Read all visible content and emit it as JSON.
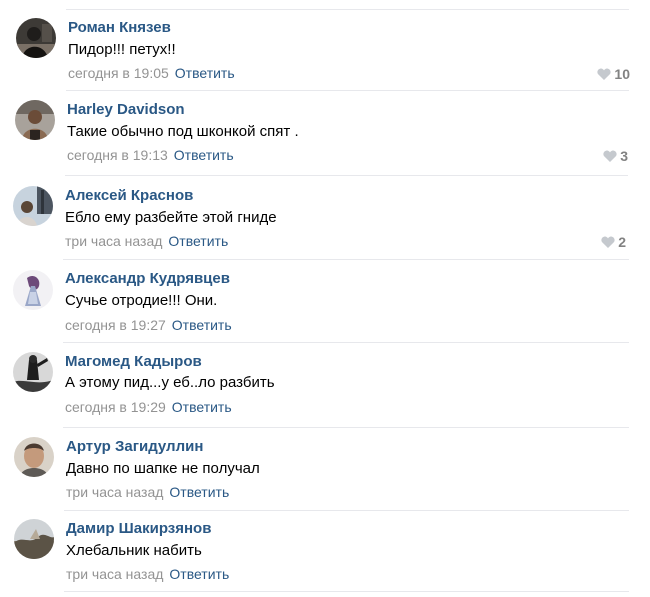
{
  "reply_label": "Ответить",
  "colors": {
    "author": "#2a5885",
    "link": "#2a5885",
    "text": "#000000",
    "time": "#939393",
    "likes": "#828282",
    "like_icon": "#c5c9ce",
    "divider": "#e7e8ec"
  },
  "comments": [
    {
      "author": "Роман Князев",
      "text": "Пидор!!! петух!!",
      "time": "сегодня в 19:05",
      "likes": "10",
      "avatar_icon": "user-avatar-photo"
    },
    {
      "author": "Harley Davidson",
      "text": "Такие обычно под шконкой спят .",
      "time": "сегодня в 19:13",
      "likes": "3",
      "avatar_icon": "user-avatar-photo"
    },
    {
      "author": "Алексей Краснов",
      "text": "Ебло ему разбейте этой гниде",
      "time": "три часа назад",
      "likes": "2",
      "avatar_icon": "user-avatar-photo"
    },
    {
      "author": "Александр Кудрявцев",
      "text": "Сучье отродие!!! Они.",
      "time": "сегодня в 19:27",
      "likes": "",
      "avatar_icon": "user-avatar-photo"
    },
    {
      "author": "Магомед Кадыров",
      "text": "А этому пид...у еб..ло разбить",
      "time": "сегодня в 19:29",
      "likes": "",
      "avatar_icon": "user-avatar-photo"
    },
    {
      "author": "Артур Загидуллин",
      "text": "Давно по шапке не получал",
      "time": "три часа назад",
      "likes": "",
      "avatar_icon": "user-avatar-photo"
    },
    {
      "author": "Дамир Шакирзянов",
      "text": "Хлебальник набить",
      "time": "три часа назад",
      "likes": "",
      "avatar_icon": "user-avatar-photo"
    }
  ]
}
